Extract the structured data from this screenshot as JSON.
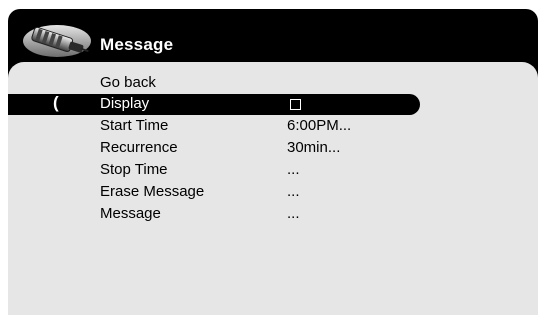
{
  "header": {
    "title": "Message",
    "icon": "remote-control-icon"
  },
  "menu": {
    "cursor": "(",
    "items": [
      {
        "label": "Go back",
        "value": ""
      },
      {
        "label": "Display",
        "value": "",
        "checkbox": "unchecked",
        "selected": true
      },
      {
        "label": "Start Time",
        "value": "6:00PM..."
      },
      {
        "label": "Recurrence",
        "value": "30min..."
      },
      {
        "label": "Stop Time",
        "value": "..."
      },
      {
        "label": "Erase Message",
        "value": "..."
      },
      {
        "label": "Message",
        "value": "..."
      }
    ]
  },
  "colors": {
    "frame": "#000000",
    "panel": "#e6e6e6",
    "highlight": "#000000",
    "text": "#000000",
    "highlight_text": "#ffffff"
  }
}
